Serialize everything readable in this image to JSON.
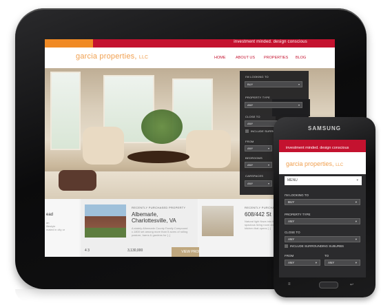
{
  "tablet": {
    "tagline": "investment minded. design conscious",
    "logo": "garcia properties,",
    "logo_llc": "LLC",
    "nav": [
      "HOME",
      "ABOUT US",
      "PROPERTIES",
      "BLOG"
    ],
    "search": {
      "looking_label": "I'M LOOKING TO",
      "looking_value": "BUY",
      "type_label": "PROPERTY TYPE",
      "type_value": "ANY",
      "close_label": "CLOSE TO",
      "close_value": "ANY",
      "include_label": "INCLUDE SURROUNDING",
      "from_label": "FROM",
      "from_value": "ANY",
      "bedroom_label": "BEDROOMS",
      "bedroom_value": "ANY",
      "carspace_label": "CARSPACES",
      "carspace_value": "ANY"
    },
    "listings": [
      {
        "head": "RECENTLY PURCHASED PROPERTY",
        "title": "Albemarle, Charlottesville, VA",
        "text": "A stately Albemarle County Family Compound c.1800 set among more than 5 acres of rolling pasture, barns & gardens for [..]",
        "price": "3,130,000",
        "button": "VIEW PROPERTY",
        "meta": "4  3"
      },
      {
        "head": "RECENTLY PURCHASED PROPERTY",
        "title": "608/442 St",
        "text": "Natural light flows into the spacious living room and large kitchen that opens [..]",
        "price": "",
        "button": "",
        "meta": ""
      }
    ],
    "left_text": "ead",
    "left_subtext": "an\nlifestyle\nmated in city or"
  },
  "phone": {
    "brand": "SAMSUNG",
    "tagline": "investment minded. design conscious",
    "logo": "garcia properties,",
    "logo_llc": "LLC",
    "menu": "MENU",
    "search": {
      "looking_label": "I'M LOOKING TO",
      "looking_value": "BUY",
      "type_label": "PROPERTY TYPE",
      "type_value": "ANY",
      "close_label": "CLOSE TO",
      "close_value": "ANY",
      "include_label": "INCLUDE SURROUNDING SUBURBS",
      "from_label": "FROM",
      "from_value": "ANY",
      "to_label": "TO",
      "to_value": "ANY"
    }
  },
  "colors": {
    "accent_red": "#c4122f",
    "accent_orange": "#f08a24",
    "logo_orange": "#f0a050",
    "panel_dark": "#1e1e20",
    "button_tan": "#bfa77e"
  }
}
